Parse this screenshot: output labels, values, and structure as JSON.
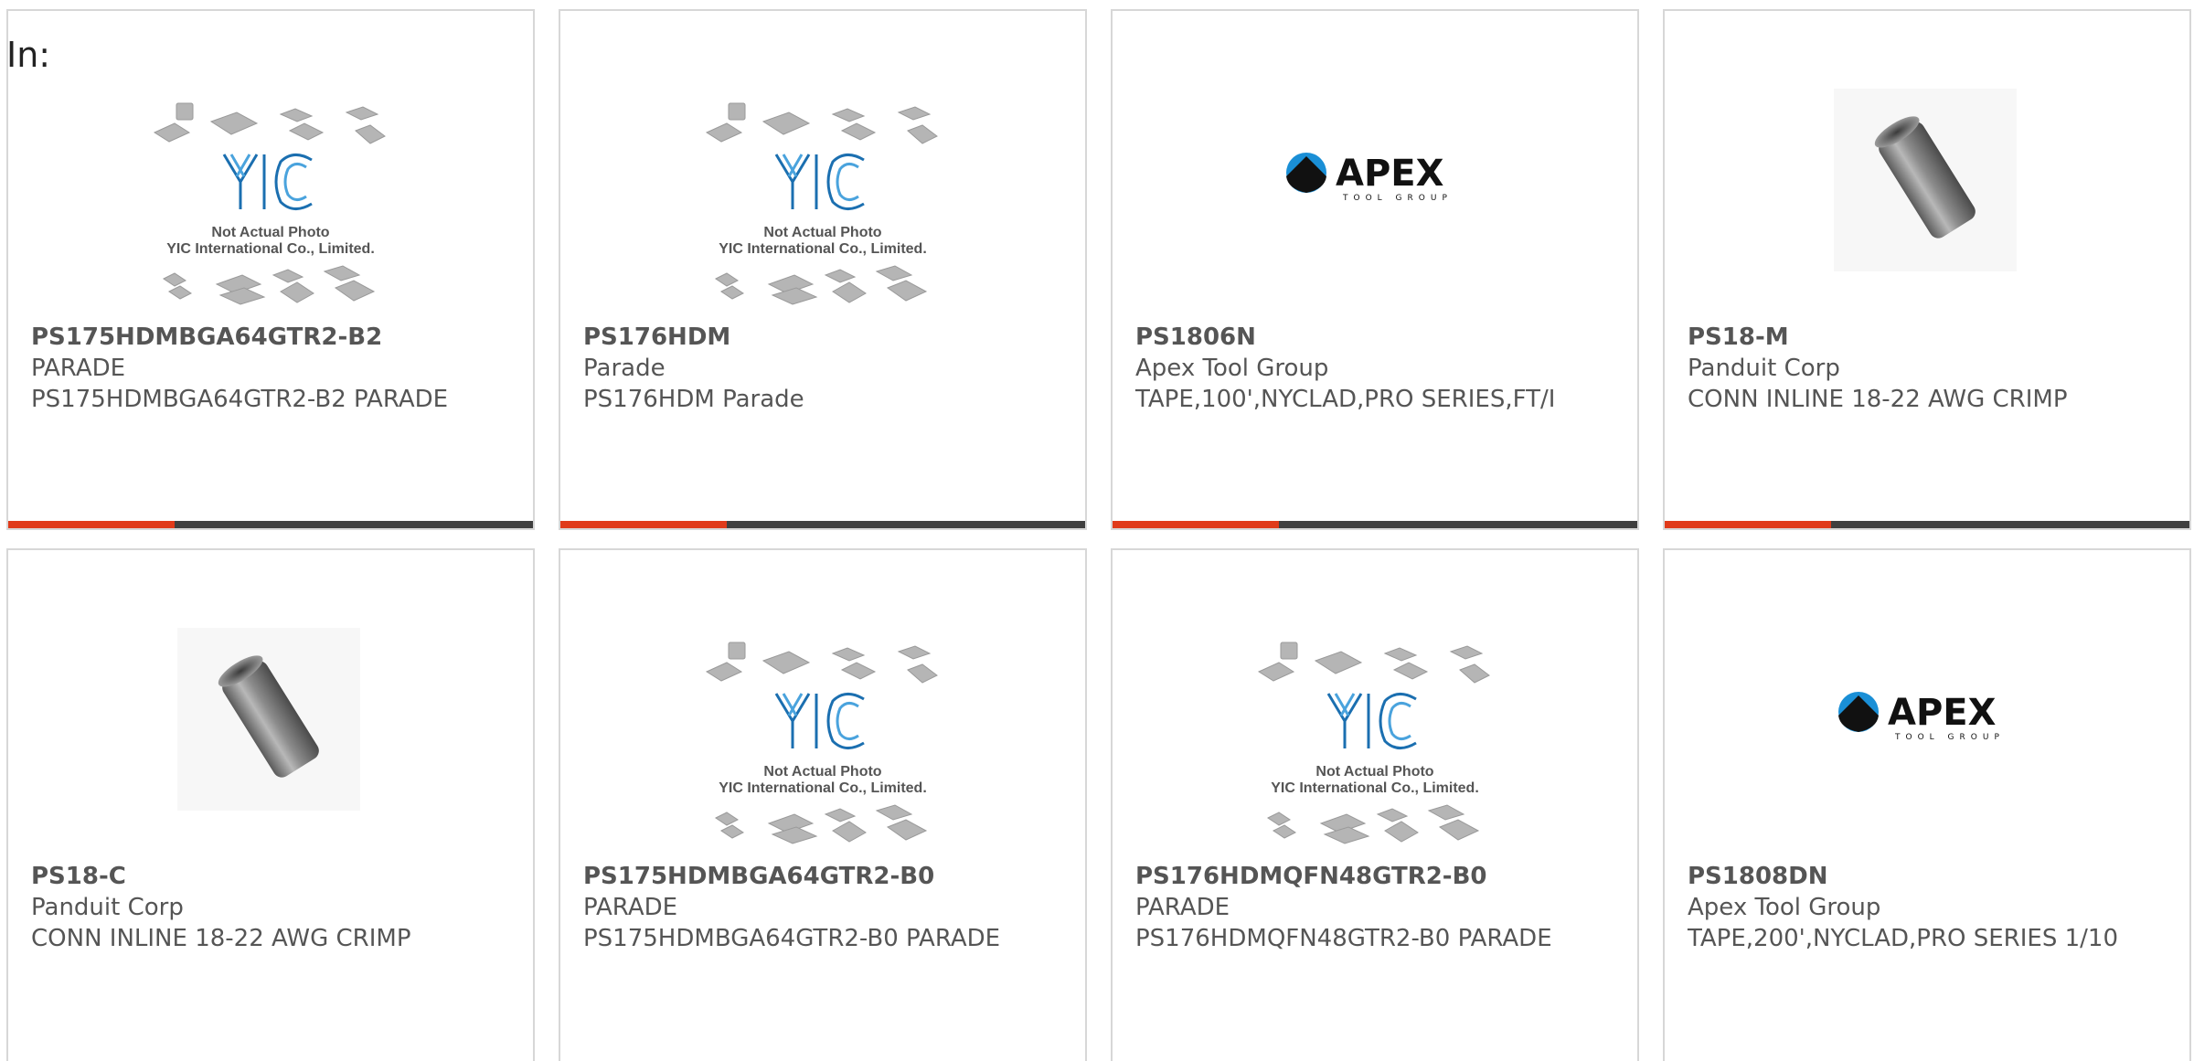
{
  "header": {
    "in_label": "In:"
  },
  "colors": {
    "accent": "#e03a1a",
    "bar": "#3f3f3f",
    "text": "#555555",
    "border": "#d7d7d7"
  },
  "placeholder": {
    "logo_text": "YIC",
    "line1": "Not Actual Photo",
    "line2": "YIC International Co., Limited."
  },
  "apex": {
    "brand": "APEX",
    "sub": "TOOL GROUP"
  },
  "cards": [
    {
      "part_number": "PS175HDMBGA64GTR2-B2",
      "manufacturer": "PARADE",
      "description": "PS175HDMBGA64GTR2-B2 PARADE",
      "image": "yic-placeholder"
    },
    {
      "part_number": "PS176HDM",
      "manufacturer": "Parade",
      "description": "PS176HDM Parade",
      "image": "yic-placeholder"
    },
    {
      "part_number": "PS1806N",
      "manufacturer": "Apex Tool Group",
      "description": "TAPE,100',NYCLAD,PRO SERIES,FT/I",
      "image": "apex-logo"
    },
    {
      "part_number": "PS18-M",
      "manufacturer": "Panduit Corp",
      "description": "CONN INLINE 18-22 AWG CRIMP",
      "image": "metal-sleeve"
    },
    {
      "part_number": "PS18-C",
      "manufacturer": "Panduit Corp",
      "description": "CONN INLINE 18-22 AWG CRIMP",
      "image": "metal-sleeve"
    },
    {
      "part_number": "PS175HDMBGA64GTR2-B0",
      "manufacturer": "PARADE",
      "description": "PS175HDMBGA64GTR2-B0 PARADE",
      "image": "yic-placeholder"
    },
    {
      "part_number": "PS176HDMQFN48GTR2-B0",
      "manufacturer": "PARADE",
      "description": "PS176HDMQFN48GTR2-B0 PARADE",
      "image": "yic-placeholder"
    },
    {
      "part_number": "PS1808DN",
      "manufacturer": "Apex Tool Group",
      "description": "TAPE,200',NYCLAD,PRO SERIES 1/10",
      "image": "apex-logo"
    }
  ]
}
